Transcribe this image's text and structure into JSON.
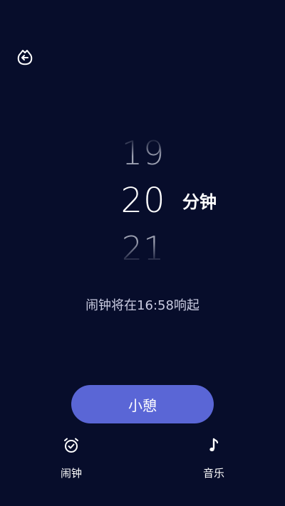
{
  "header": {
    "back_icon": "back-arrow-icon"
  },
  "picker": {
    "previous": "19",
    "current": "20",
    "next": "21",
    "unit": "分钟"
  },
  "alarm_note": "闹钟将在16:58响起",
  "snooze_button": {
    "label": "小憩"
  },
  "bottom_nav": {
    "items": [
      {
        "label": "闹钟",
        "icon": "alarm-clock-icon"
      },
      {
        "label": "音乐",
        "icon": "music-note-icon"
      }
    ]
  },
  "colors": {
    "background": "#070d2b",
    "accent": "#5a66d6",
    "text_primary": "#ffffff",
    "text_secondary": "#c9cbe0"
  }
}
